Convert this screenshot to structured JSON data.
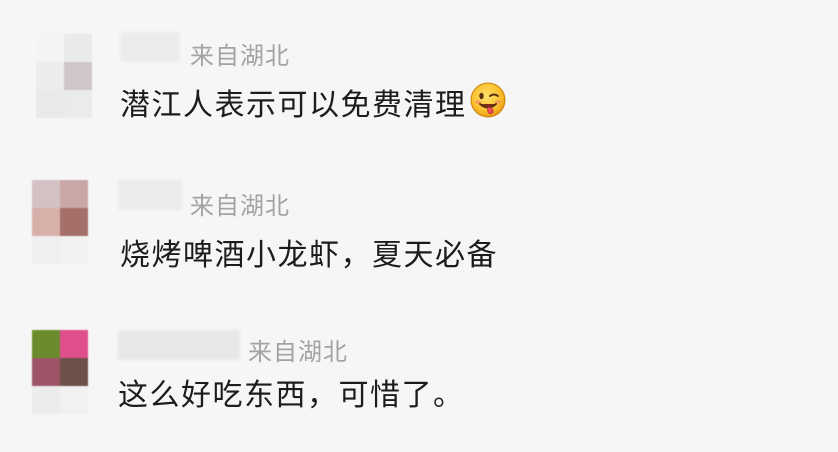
{
  "comments": [
    {
      "location": "来自湖北",
      "text": "潜江人表示可以免费清理",
      "emoji": "winking-tongue-emoji",
      "avatar_colors": [
        "#f4f4f4",
        "#eaeaea",
        "#ececec",
        "#cfc6c8",
        "#e9e9e9",
        "#ebebeb"
      ],
      "name_color": "#ececec"
    },
    {
      "location": "来自湖北",
      "text": "烧烤啤酒小龙虾，夏天必备",
      "emoji": "",
      "avatar_colors": [
        "#d4c1c4",
        "#c8a7a6",
        "#d8b0aa",
        "#a6706a",
        "#efefef",
        "#f2f2f2"
      ],
      "name_color": "#ebebeb"
    },
    {
      "location": "来自湖北",
      "text": "这么好吃东西，可惜了。",
      "emoji": "",
      "avatar_colors": [
        "#6b8b2c",
        "#de4f8c",
        "#9e5466",
        "#6d5149",
        "#ececec",
        "#f1f1f1"
      ],
      "name_color": "#e8e8e8"
    }
  ],
  "colors": {
    "background": "#f6f6f6",
    "location_text": "#a3a3a3",
    "body_text": "#1c1c1c"
  }
}
